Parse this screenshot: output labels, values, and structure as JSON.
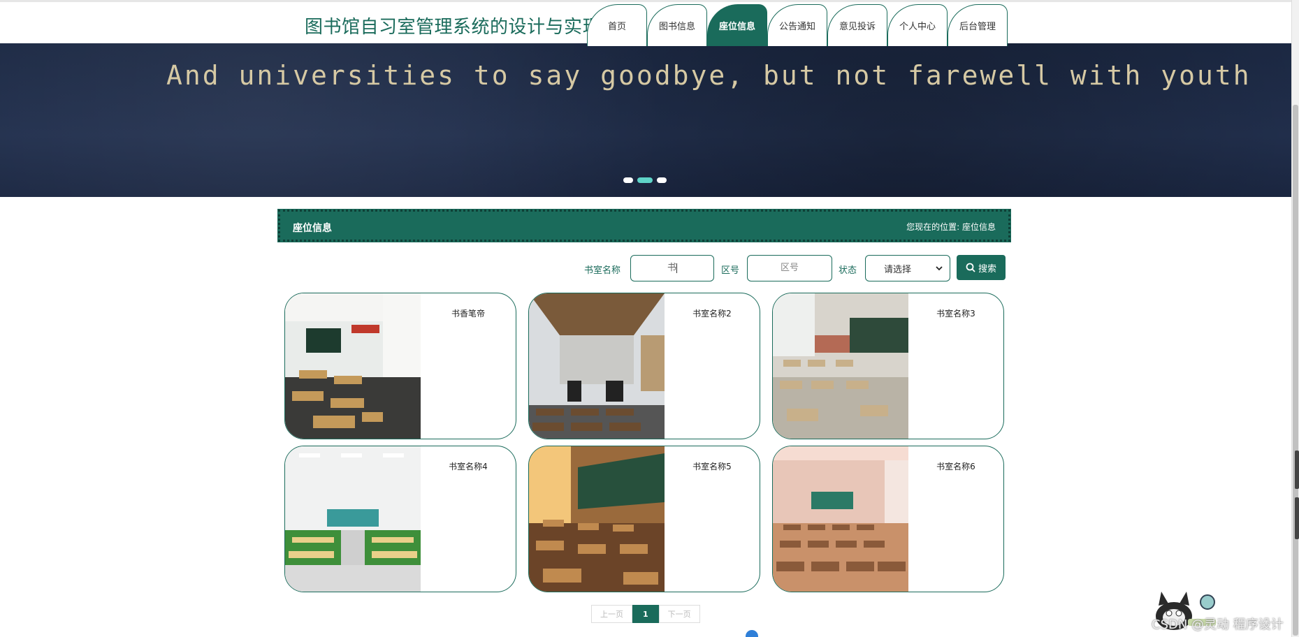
{
  "header": {
    "title": "图书馆自习室管理系统的设计与实现",
    "nav": [
      "首页",
      "图书信息",
      "座位信息",
      "公告通知",
      "意见投诉",
      "个人中心",
      "后台管理"
    ],
    "active_index": 2
  },
  "banner": {
    "text": "And universities to say goodbye, but not farewell with youth",
    "slide_count": 3,
    "active_slide": 1
  },
  "section": {
    "title": "座位信息",
    "location_prefix": "您现在的位置:",
    "location": "座位信息"
  },
  "search": {
    "room_label": "书室名称",
    "room_value": "书",
    "zone_label": "区号",
    "zone_placeholder": "区号",
    "status_label": "状态",
    "status_selected": "请选择",
    "button_label": "搜索"
  },
  "cards": [
    {
      "name": "书香笔帝"
    },
    {
      "name": "书室名称2"
    },
    {
      "name": "书室名称3"
    },
    {
      "name": "书室名称4"
    },
    {
      "name": "书室名称5"
    },
    {
      "name": "书室名称6"
    }
  ],
  "pager": {
    "prev": "上一页",
    "current": "1",
    "next": "下一页"
  },
  "watermark": "CSDN @灵动 程序设计",
  "colors": {
    "accent": "#1a6b5b",
    "banner": "#1f2d4a",
    "dot_active": "#5fd4c8"
  }
}
